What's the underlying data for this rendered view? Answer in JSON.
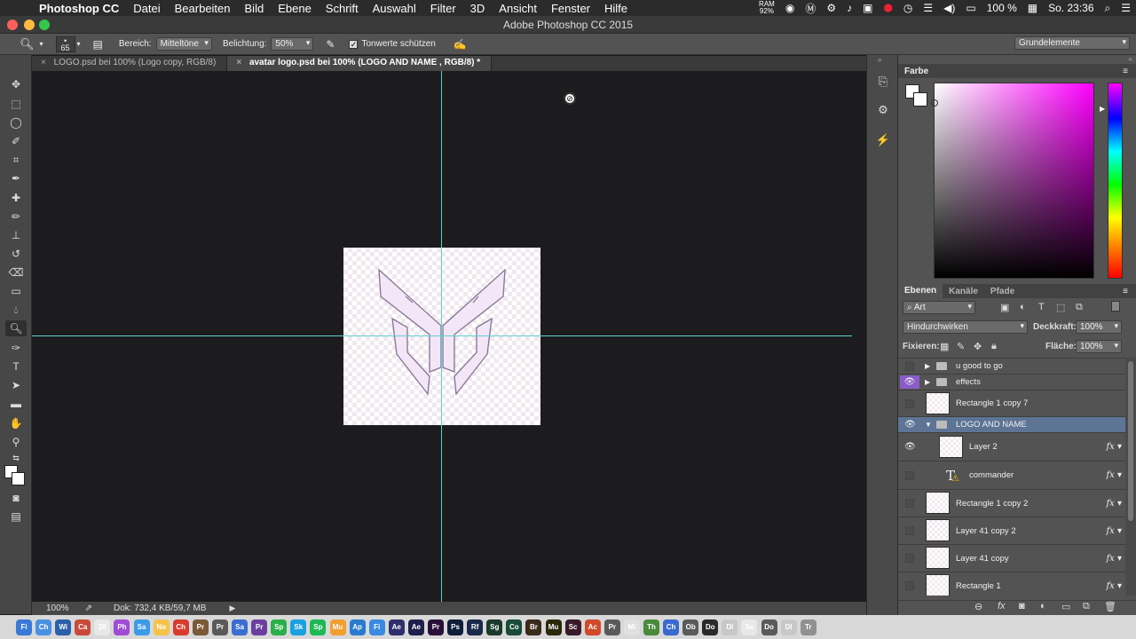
{
  "menubar": {
    "app_name": "Photoshop CC",
    "items": [
      "Datei",
      "Bearbeiten",
      "Bild",
      "Ebene",
      "Schrift",
      "Auswahl",
      "Filter",
      "3D",
      "Ansicht",
      "Fenster",
      "Hilfe"
    ],
    "ram_label": "RAM",
    "ram_value": "92%",
    "battery": "100 %",
    "clock": "So. 23:36"
  },
  "window": {
    "title": "Adobe Photoshop CC 2015"
  },
  "options_bar": {
    "brush_size": "65",
    "range_label": "Bereich:",
    "range_value": "Mitteltöne",
    "exposure_label": "Belichtung:",
    "exposure_value": "50%",
    "protect_tones_label": "Tonwerte schützen",
    "workspace": "Grundelemente"
  },
  "tabs": [
    {
      "label": "LOGO.psd bei 100% (Logo  copy, RGB/8)"
    },
    {
      "label": "avatar logo.psd bei 100% (LOGO AND NAME , RGB/8) *"
    }
  ],
  "status": {
    "zoom": "100%",
    "doc": "Dok: 732,4 KB/59,7 MB"
  },
  "color_panel": {
    "title": "Farbe"
  },
  "layers_panel": {
    "tabs": [
      "Ebenen",
      "Kanäle",
      "Pfade"
    ],
    "filter_kind": "Art",
    "blend_mode": "Hindurchwirken",
    "opacity_label": "Deckkraft:",
    "opacity_value": "100%",
    "lock_label": "Fixieren:",
    "fill_label": "Fläche:",
    "fill_value": "100%",
    "layers": [
      {
        "name": "u good to go",
        "kind": "group",
        "visible": false,
        "fx": false
      },
      {
        "name": "effects",
        "kind": "group",
        "visible": true,
        "fx": false
      },
      {
        "name": "Rectangle 1 copy 7",
        "kind": "pixel",
        "visible": false,
        "fx": false
      },
      {
        "name": "LOGO AND NAME",
        "kind": "group-open",
        "visible": true,
        "fx": false
      },
      {
        "name": "Layer 2",
        "kind": "pixel",
        "visible": true,
        "fx": true
      },
      {
        "name": "commander",
        "kind": "text",
        "visible": false,
        "fx": true
      },
      {
        "name": "Rectangle 1 copy 2",
        "kind": "pixel",
        "visible": false,
        "fx": true
      },
      {
        "name": "Layer 41 copy 2",
        "kind": "pixel",
        "visible": false,
        "fx": true
      },
      {
        "name": "Layer 41 copy",
        "kind": "pixel",
        "visible": false,
        "fx": true
      },
      {
        "name": "Rectangle 1",
        "kind": "pixel",
        "visible": false,
        "fx": true
      }
    ]
  },
  "colors": {
    "accent_selected": "#5d7495",
    "guide": "#5fd0d0",
    "effects_eye": "#8a5cc8"
  },
  "dock": {
    "apps": [
      "Fi",
      "Ch",
      "Wi",
      "Ca",
      "28",
      "Ph",
      "Sa",
      "No",
      "Ch",
      "Pr",
      "Pr",
      "Sa",
      "Pr",
      "Sp",
      "Sk",
      "Sp",
      "Mu",
      "Ap",
      "Fi",
      "Ae",
      "Ae",
      "Pr",
      "Ps",
      "Rf",
      "Sg",
      "Co",
      "Br",
      "Mu",
      "Sc",
      "Ac",
      "Pr",
      "Mi",
      "Th",
      "Ch",
      "Ob",
      "Do",
      "Dl",
      "Se",
      "Do",
      "Dl",
      "Tr"
    ]
  }
}
